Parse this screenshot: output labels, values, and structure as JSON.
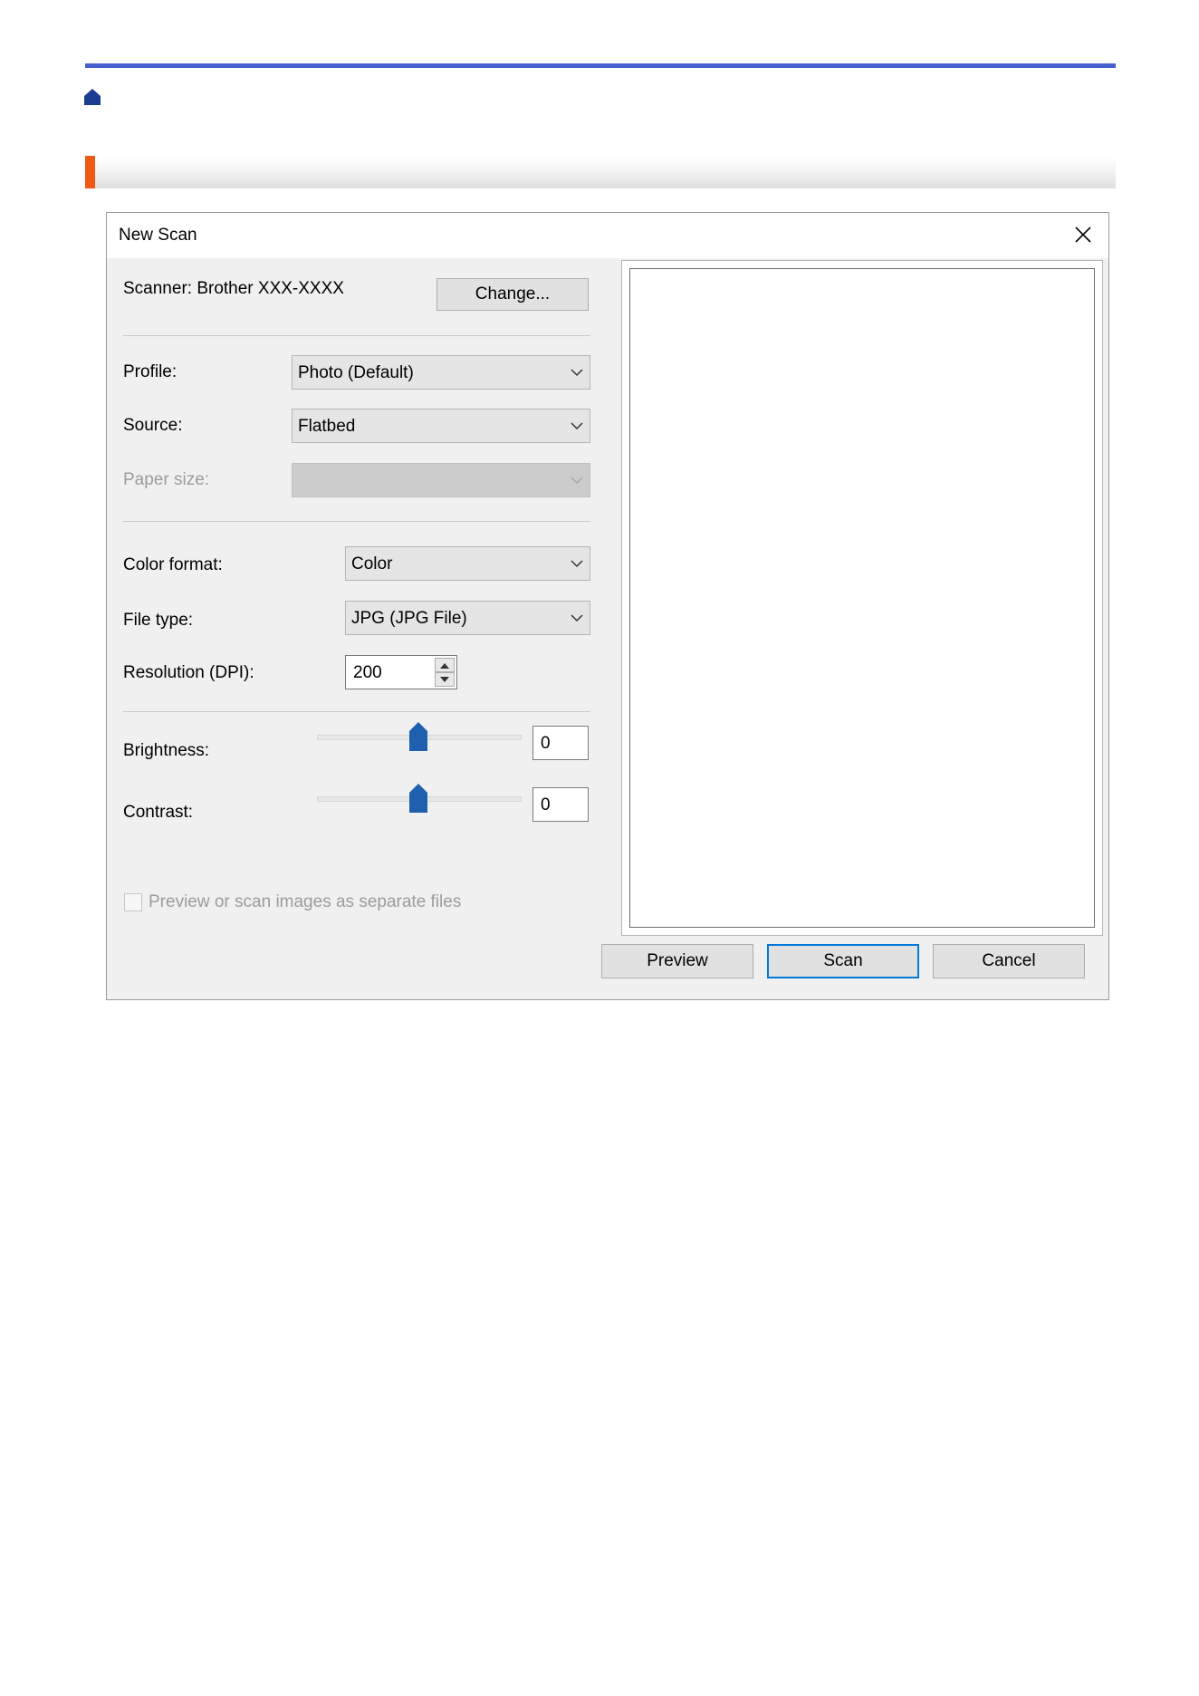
{
  "icons": {
    "home": "home-icon",
    "close": "close-icon",
    "dropdown": "chevron-down-icon"
  },
  "colors": {
    "rule": "#4a5fcf",
    "accent": "#f05a14",
    "focus": "#0078d7",
    "slider_thumb": "#1e5fae"
  },
  "dialog": {
    "title": "New Scan",
    "scanner_text": "Scanner: Brother XXX-XXXX",
    "change_button": "Change...",
    "profile": {
      "label": "Profile:",
      "value": "Photo (Default)"
    },
    "source": {
      "label": "Source:",
      "value": "Flatbed"
    },
    "paper_size": {
      "label": "Paper size:",
      "value": ""
    },
    "color_format": {
      "label": "Color format:",
      "value": "Color"
    },
    "file_type": {
      "label": "File type:",
      "value": "JPG (JPG File)"
    },
    "resolution": {
      "label": "Resolution (DPI):",
      "value": "200"
    },
    "brightness": {
      "label": "Brightness:",
      "value": "0",
      "level": 0
    },
    "contrast": {
      "label": "Contrast:",
      "value": "0",
      "level": 0
    },
    "separate_files": {
      "label": "Preview or scan images as separate files",
      "checked": false
    },
    "buttons": {
      "preview": "Preview",
      "scan": "Scan",
      "cancel": "Cancel"
    }
  }
}
